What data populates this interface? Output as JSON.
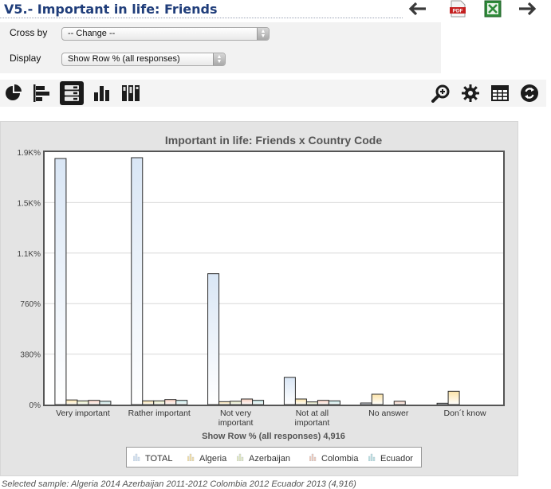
{
  "header": {
    "title": "V5.- Important in life: Friends",
    "nav_icons": [
      "back-arrow-icon",
      "pdf-export-icon",
      "excel-export-icon",
      "forward-arrow-icon"
    ],
    "pdf_badge": "PDF"
  },
  "controls": {
    "cross_by_label": "Cross by",
    "cross_by_value": "-- Change --",
    "display_label": "Display",
    "display_value": "Show Row % (all responses)"
  },
  "toolbar": {
    "left_icons": [
      "pie-chart-icon",
      "horizontal-bar-icon",
      "stacked-bar-icon",
      "column-chart-icon",
      "stacked-column-icon"
    ],
    "active": "stacked-bar-icon",
    "right_icons": [
      "zoom-icon",
      "settings-gear-icon",
      "table-icon",
      "refresh-icon"
    ]
  },
  "chart_data": {
    "type": "bar",
    "title": "Important in life: Friends x Country Code",
    "xlabel": "Show Row % (all responses) 4,916",
    "ylabel": "",
    "y_ticks": [
      "0%",
      "380%",
      "760%",
      "1.1K%",
      "1.5K%",
      "1.9K%"
    ],
    "ylim": [
      0,
      1900
    ],
    "categories": [
      "Very important",
      "Rather important",
      "Not very important",
      "Not at all important",
      "No answer",
      "Don´t know"
    ],
    "category_lines": [
      [
        "Very important"
      ],
      [
        "Rather important"
      ],
      [
        "Not very",
        "important"
      ],
      [
        "Not at all",
        "important"
      ],
      [
        "No answer"
      ],
      [
        "Don´t know"
      ]
    ],
    "series": [
      {
        "name": "TOTAL",
        "color": "#d9e6f5",
        "values": [
          1852,
          1858,
          985,
          205,
          12,
          10
        ]
      },
      {
        "name": "Algeria",
        "color": "#fbe3a8",
        "values": [
          35,
          28,
          22,
          42,
          78,
          100
        ]
      },
      {
        "name": "Azerbaijan",
        "color": "#e7ecc0",
        "values": [
          28,
          28,
          25,
          20,
          0,
          0
        ]
      },
      {
        "name": "Colombia",
        "color": "#f7cdbd",
        "values": [
          32,
          38,
          42,
          32,
          25,
          0
        ]
      },
      {
        "name": "Ecuador",
        "color": "#bfe3e3",
        "values": [
          25,
          32,
          32,
          28,
          0,
          0
        ]
      }
    ],
    "grid": true,
    "legend_position": "bottom"
  },
  "footer": {
    "note": "Selected sample: Algeria 2014 Azerbaijan 2011-2012 Colombia 2012 Ecuador 2013 (4,916)"
  }
}
